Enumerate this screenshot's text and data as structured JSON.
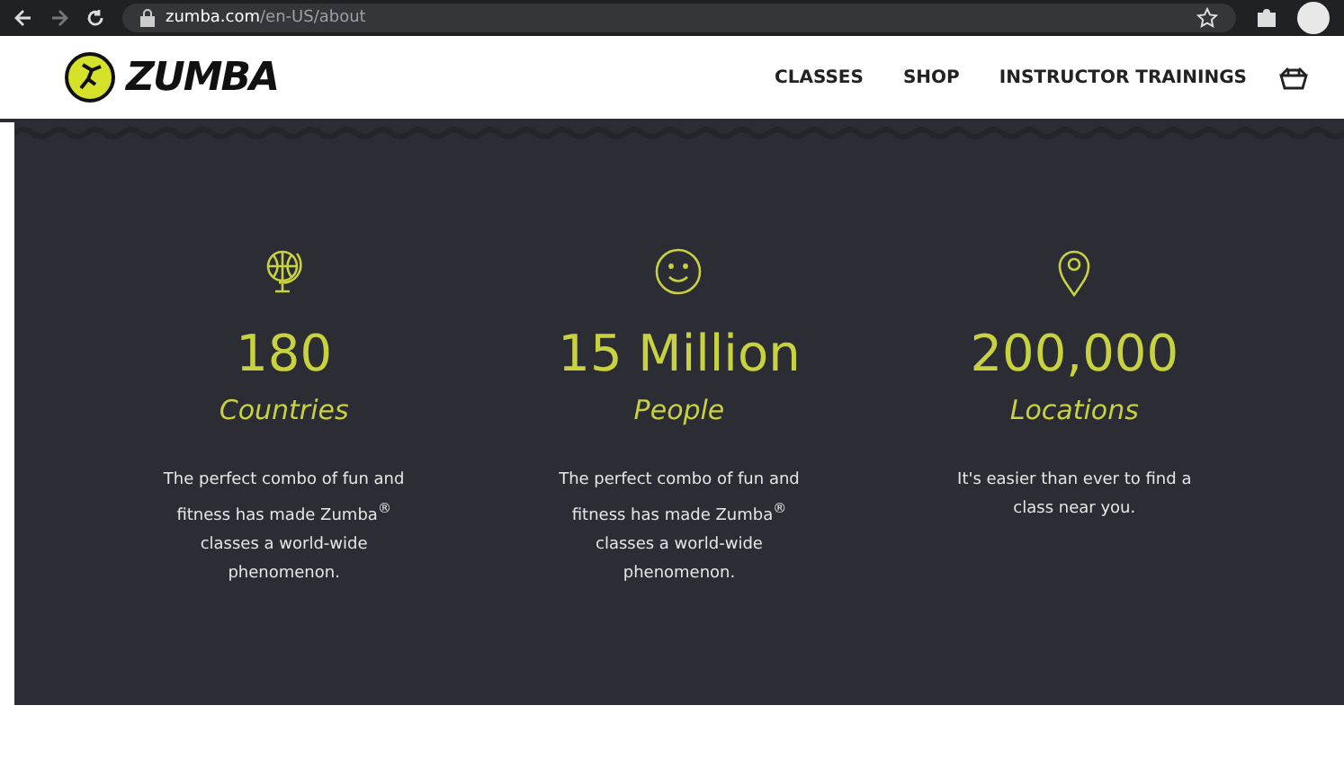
{
  "browser": {
    "url_host": "zumba.com",
    "url_path": "/en-US/about"
  },
  "header": {
    "logo": "ZUMBA",
    "nav": [
      "CLASSES",
      "SHOP",
      "INSTRUCTOR TRAININGS"
    ]
  },
  "stats": [
    {
      "kind": "globe",
      "value": "180",
      "label": "Countries",
      "text": "The perfect combo of fun and fitness has made Zumba$^{®}$ classes a world-wide phenomenon."
    },
    {
      "kind": "smile",
      "value": "15 Million",
      "label": "People",
      "text": "The perfect combo of fun and fitness has made Zumba$^{®}$ classes a world-wide phenomenon."
    },
    {
      "kind": "pin",
      "value": "200,000",
      "label": "Locations",
      "text": "It's easier than ever to find a class near you."
    }
  ]
}
